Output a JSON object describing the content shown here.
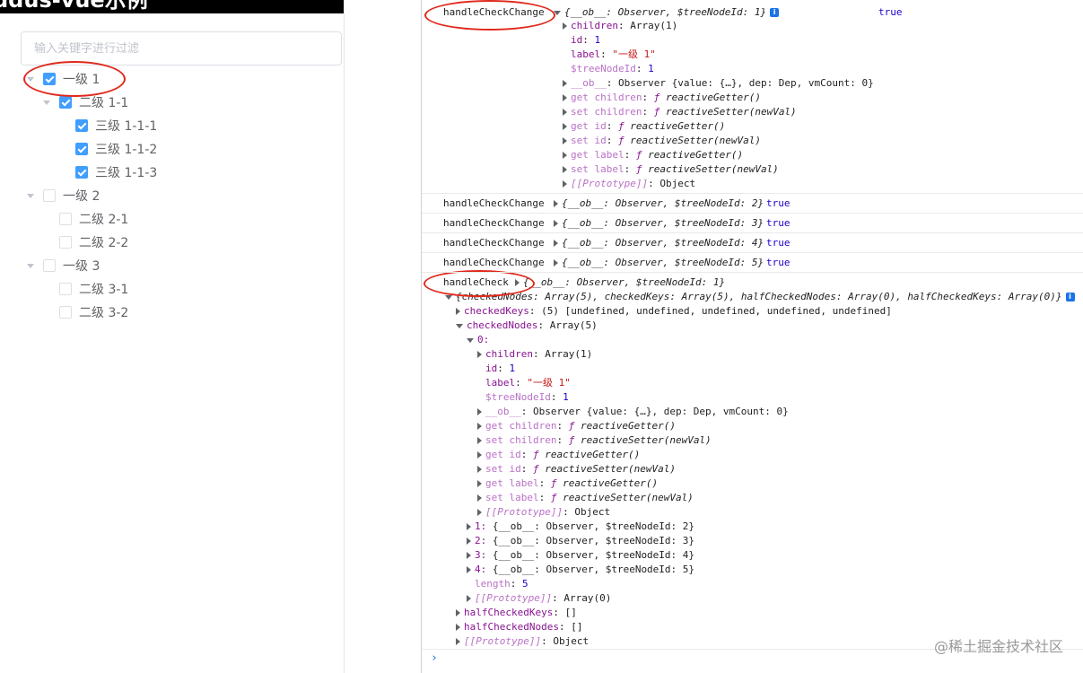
{
  "left": {
    "title": "ddus-vue示例",
    "filter_placeholder": "输入关键字进行过滤",
    "tree": [
      {
        "label": "一级 1",
        "level": 0,
        "checked": true,
        "expanded": true
      },
      {
        "label": "二级 1-1",
        "level": 1,
        "checked": true,
        "expanded": true
      },
      {
        "label": "三级 1-1-1",
        "level": 2,
        "checked": true,
        "leaf": true
      },
      {
        "label": "三级 1-1-2",
        "level": 2,
        "checked": true,
        "leaf": true
      },
      {
        "label": "三级 1-1-3",
        "level": 2,
        "checked": true,
        "leaf": true
      },
      {
        "label": "一级 2",
        "level": 0,
        "checked": false,
        "expanded": true
      },
      {
        "label": "二级 2-1",
        "level": 1,
        "checked": false,
        "leaf": true
      },
      {
        "label": "二级 2-2",
        "level": 1,
        "checked": false,
        "leaf": true
      },
      {
        "label": "一级 3",
        "level": 0,
        "checked": false,
        "expanded": true
      },
      {
        "label": "二级 3-1",
        "level": 1,
        "checked": false,
        "leaf": true
      },
      {
        "label": "二级 3-2",
        "level": 1,
        "checked": false,
        "leaf": true
      }
    ]
  },
  "console": {
    "fn_change": "handleCheckChange",
    "fn_check": "handleCheck",
    "bool_true": "true",
    "entry1": {
      "summary": "{__ob__: Observer, $treeNodeId: 1}",
      "props": {
        "children": "Array(1)",
        "id": "1",
        "label": "\"一级 1\"",
        "tree_node_id": "1",
        "ob": "Observer {value: {…}, dep: Dep, vmCount: 0}",
        "get_children": "reactiveGetter()",
        "set_children": "reactiveSetter(newVal)",
        "get_id": "reactiveGetter()",
        "set_id": "reactiveSetter(newVal)",
        "get_label": "reactiveGetter()",
        "set_label": "reactiveSetter(newVal)",
        "prototype": "Object"
      }
    },
    "entries": [
      "{__ob__: Observer, $treeNodeId: 2}",
      "{__ob__: Observer, $treeNodeId: 3}",
      "{__ob__: Observer, $treeNodeId: 4}",
      "{__ob__: Observer, $treeNodeId: 5}"
    ],
    "check_entry": {
      "summary": "{__ob__: Observer, $treeNodeId: 1}",
      "second_summary": "{checkedNodes: Array(5), checkedKeys: Array(5), halfCheckedNodes: Array(0), halfCheckedKeys: Array(0)}",
      "checked_keys": "(5) [undefined, undefined, undefined, undefined, undefined]",
      "checked_nodes": "Array(5)",
      "node0_index": "0:",
      "nodes_rest": [
        {
          "idx": "1:",
          "text": "{__ob__: Observer, $treeNodeId: 2}"
        },
        {
          "idx": "2:",
          "text": "{__ob__: Observer, $treeNodeId: 3}"
        },
        {
          "idx": "3:",
          "text": "{__ob__: Observer, $treeNodeId: 4}"
        },
        {
          "idx": "4:",
          "text": "{__ob__: Observer, $treeNodeId: 5}"
        }
      ],
      "length": "5",
      "nodes_prototype": "Array(0)",
      "half_checked_keys": "[]",
      "half_checked_nodes": "[]",
      "prototype": "Object"
    },
    "prompt": "›"
  },
  "watermark": "@稀土掘金技术社区"
}
